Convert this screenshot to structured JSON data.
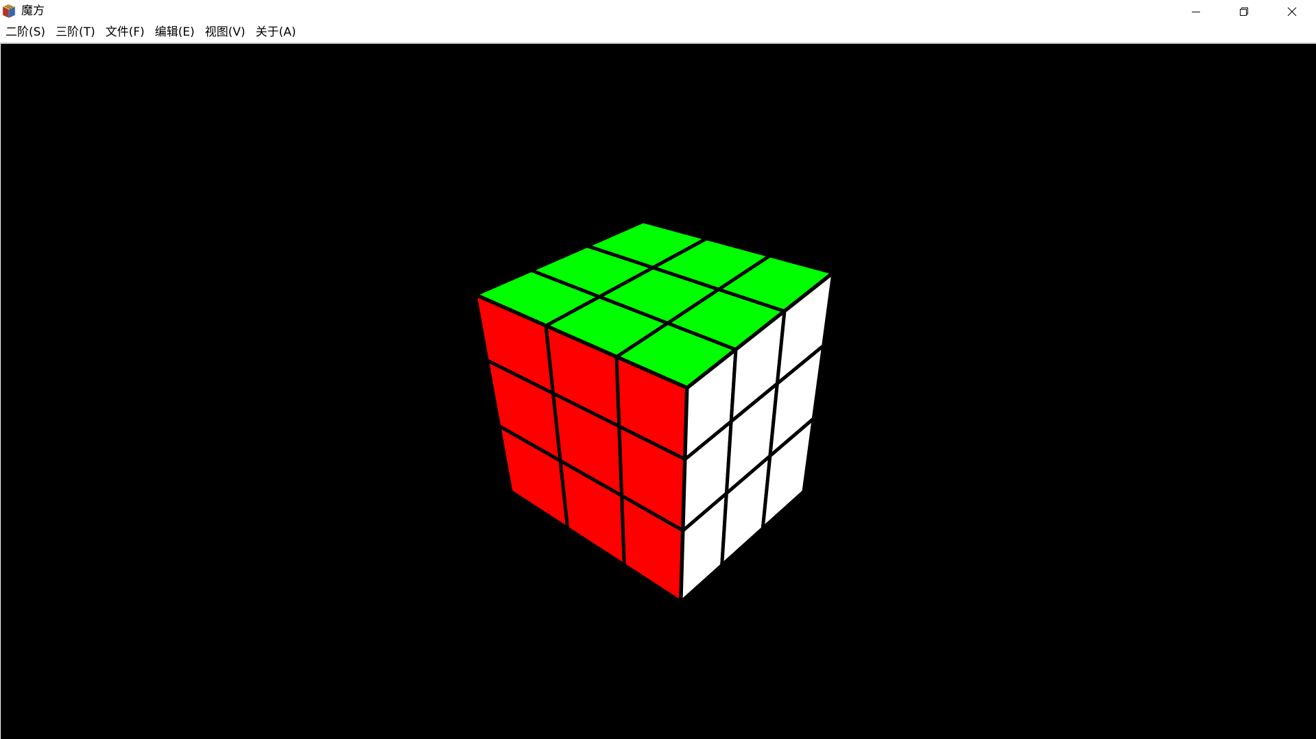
{
  "window": {
    "title": "魔方",
    "icon": "rubiks-cube-app-icon",
    "controls": {
      "minimize_icon": "minimize-icon",
      "restore_icon": "restore-icon",
      "close_icon": "close-icon"
    }
  },
  "menu": {
    "items": [
      {
        "label": "二阶(S)"
      },
      {
        "label": "三阶(T)"
      },
      {
        "label": "文件(F)"
      },
      {
        "label": "编辑(E)"
      },
      {
        "label": "视图(V)"
      },
      {
        "label": "关于(A)"
      }
    ]
  },
  "scene": {
    "background_color": "#000000",
    "cube_order": 3,
    "face_colors": {
      "top": "#00ff00",
      "left": "#ff0000",
      "right": "#ffffff"
    },
    "grid_color": "#000000"
  }
}
